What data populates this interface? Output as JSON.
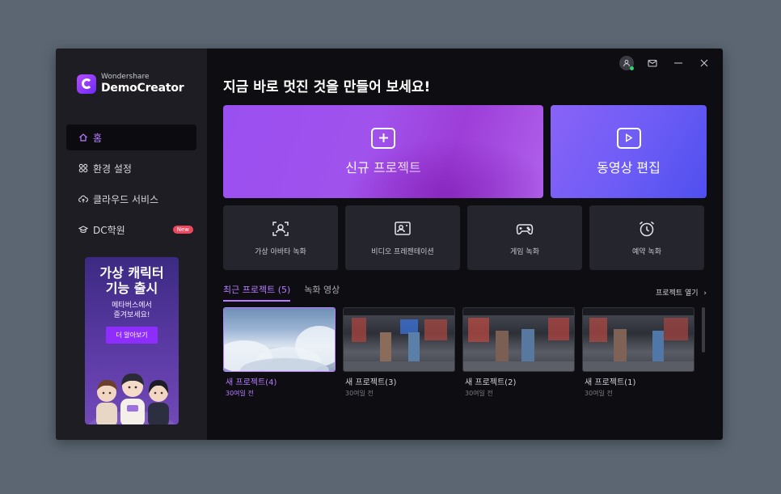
{
  "app": {
    "brand": "Wondershare",
    "name": "DemoCreator"
  },
  "sidebar": {
    "items": [
      {
        "label": "홈",
        "icon": "home-icon",
        "active": true
      },
      {
        "label": "환경 설정",
        "icon": "settings-grid-icon"
      },
      {
        "label": "클라우드 서비스",
        "icon": "cloud-upload-icon"
      },
      {
        "label": "DC학원",
        "icon": "graduation-cap-icon",
        "badge": "New"
      }
    ]
  },
  "banner": {
    "title_line1": "가상 캐릭터",
    "title_line2": "기능 출시",
    "sub_line1": "메타버스에서",
    "sub_line2": "즐겨보세요!",
    "button": "더 알아보기"
  },
  "main": {
    "headline": "지금 바로 멋진 것을 만들어 보세요!",
    "big_cards": [
      {
        "label": "신규 프로젝트",
        "icon": "plus-icon"
      },
      {
        "label": "동영상 편집",
        "icon": "play-icon"
      }
    ],
    "small_cards": [
      {
        "label": "가상 아바타 녹화",
        "icon": "avatar-frame-icon"
      },
      {
        "label": "비디오 프레젠테이션",
        "icon": "presentation-icon"
      },
      {
        "label": "게임 녹화",
        "icon": "gamepad-icon"
      },
      {
        "label": "예약 녹화",
        "icon": "alarm-clock-icon"
      }
    ],
    "tabs": [
      {
        "label": "최근 프로젝트 (5)",
        "active": true
      },
      {
        "label": "녹화 영상"
      }
    ],
    "open_project": "프로젝트 열기",
    "projects": [
      {
        "name": "새 프로젝트(4)",
        "time": "30여일 전",
        "thumb": "sky"
      },
      {
        "name": "새 프로젝트(3)",
        "time": "30여일 전",
        "thumb": "game"
      },
      {
        "name": "새 프로젝트(2)",
        "time": "30여일 전",
        "thumb": "game"
      },
      {
        "name": "새 프로젝트(1)",
        "time": "30여일 전",
        "thumb": "game"
      }
    ]
  },
  "colors": {
    "accent": "#b77cff",
    "sidebar_bg": "#1d1d23",
    "main_bg": "#0d0d12",
    "badge": "#f0475f"
  }
}
